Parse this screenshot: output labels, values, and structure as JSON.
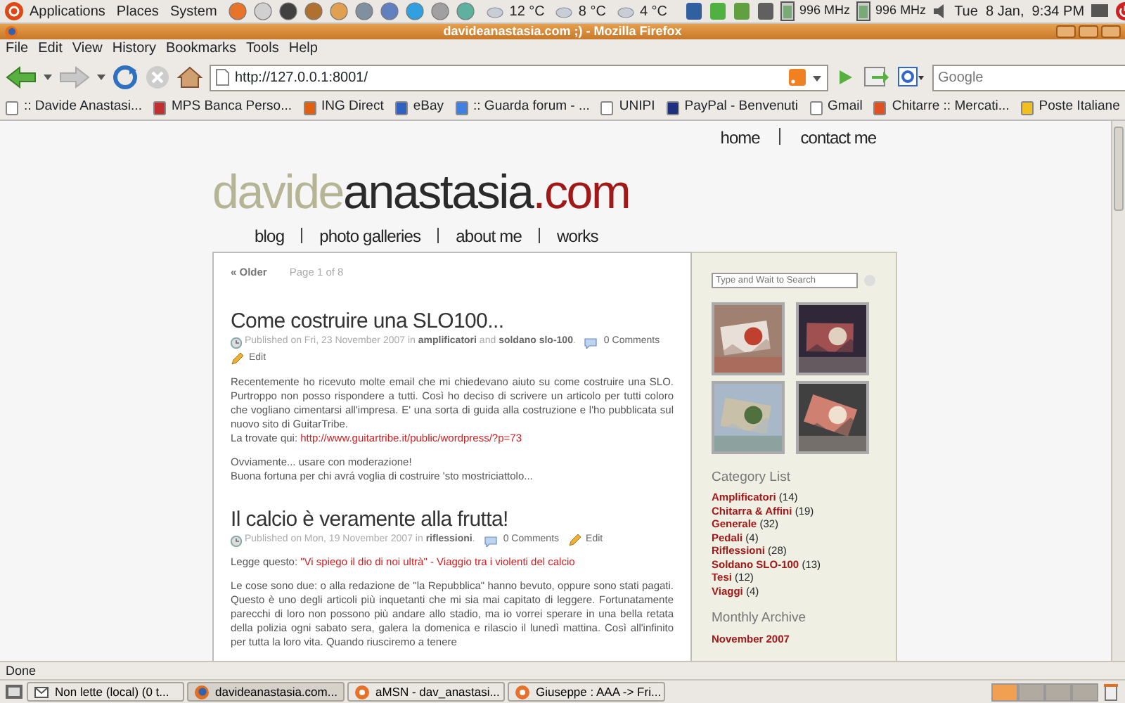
{
  "top_panel": {
    "menus": [
      "Applications",
      "Places",
      "System"
    ],
    "launchers": [
      {
        "color": "#e8742a"
      },
      {
        "color": "#d0d0d0"
      },
      {
        "color": "#404040"
      },
      {
        "color": "#b07030"
      },
      {
        "color": "#e0a050"
      },
      {
        "color": "#8090a0"
      },
      {
        "color": "#6080c0"
      },
      {
        "color": "#30a0e0"
      },
      {
        "color": "#a0a0a0"
      },
      {
        "color": "#60b0a0"
      }
    ],
    "weather": [
      {
        "temp": "12 °C"
      },
      {
        "temp": "8 °C"
      },
      {
        "temp": "4 °C"
      }
    ],
    "cpu": [
      "996 MHz",
      "996 MHz"
    ],
    "clock": "Tue  8 Jan,  9:34 PM"
  },
  "window": {
    "title": "davideanastasia.com ;) - Mozilla Firefox"
  },
  "menu_bar": [
    "File",
    "Edit",
    "View",
    "History",
    "Bookmarks",
    "Tools",
    "Help"
  ],
  "toolbar": {
    "url": "http://127.0.0.1:8001/",
    "search": {
      "placeholder": "Google"
    }
  },
  "bookmarks": [
    {
      "label": ":: Davide Anastasi...",
      "color": "#ffffff"
    },
    {
      "label": "MPS Banca Perso...",
      "color": "#c03030"
    },
    {
      "label": "ING Direct",
      "color": "#e06010"
    },
    {
      "label": "eBay",
      "color": "#3060c0"
    },
    {
      "label": ":: Guarda forum - ...",
      "color": "#4080e0"
    },
    {
      "label": "UNIPI",
      "color": "#ffffff"
    },
    {
      "label": "PayPal - Benvenuti",
      "color": "#203080"
    },
    {
      "label": "Gmail",
      "color": "#ffffff"
    },
    {
      "label": "Chitarre :: Mercati...",
      "color": "#e05020"
    },
    {
      "label": "Poste Italiane",
      "color": "#f0c020"
    }
  ],
  "page": {
    "top_links": [
      "home",
      "contact me"
    ],
    "logo": [
      {
        "text": "davide",
        "color": "#b5b596"
      },
      {
        "text": "anastasia",
        "color": "#2a2a2a"
      },
      {
        "text": ".com",
        "color": "#a01818"
      }
    ],
    "nav": [
      "blog",
      "photo galleries",
      "about me",
      "works"
    ],
    "pager": {
      "older": "« Older",
      "page": "Page 1 of 8"
    },
    "posts": [
      {
        "title": "Come costruire una SLO100...",
        "meta": "Published on Fri, 23 November 2007 in **amplificatori** and **soldano slo-100**.",
        "comments": "0 Comments",
        "edit": "Edit",
        "paragraphs": [
          [
            {
              "text": "Recentemente ho ricevuto molte email che mi chiedevano aiuto su come costruire una SLO. Purtroppo non posso rispondere a tutti. Così ho deciso di scrivere un articolo per tutti coloro che vogliano cimentarsi all'impresa. E' una sorta di guida alla costruzione e l'ho pubblicata sul nuovo sito di GuitarTribe."
            },
            {
              "text": "La trovate qui:",
              "link": "http://www.guitartribe.it/public/wordpress/?p=73"
            }
          ],
          [
            {
              "text": "Ovviamente... usare con moderazione!"
            },
            {
              "text": "Buona fortuna per chi avrá voglia di costruire 'sto mostriciattolo..."
            }
          ]
        ]
      },
      {
        "title": "Il calcio è veramente alla frutta!",
        "meta": "Published on Mon, 19 November 2007 in **riflessioni**.",
        "comments": "0 Comments",
        "edit": "Edit",
        "paragraphs": [
          [
            {
              "text": "Legge questo:",
              "link": "\"Vi spiego il dio di noi ultrà\" - Viaggio tra i violenti del calcio"
            }
          ],
          [
            {
              "text": "Le cose sono due: o alla redazione de \"la Repubblica\" hanno bevuto, oppure sono stati pagati. Questo è uno degli articoli più inquetanti che mi sia mai capitato di leggere. Fortunatamente parecchi di loro non possono più andare allo stadio, ma io vorrei sperare in una bella retata della polizia ogni sabato sera, galera la domenica e rilascio il lunedì mattina. Così all'infinito per tutta la loro vita. Quando riusciremo a tenere"
            }
          ]
        ]
      }
    ],
    "sidebar": {
      "search": {
        "placeholder": "Type and Wait to Search"
      },
      "photos": [
        {
          "kind": "picture"
        },
        {
          "kind": "picture"
        },
        {
          "kind": "picture"
        },
        {
          "kind": "picture"
        }
      ],
      "category_heading": "Category List",
      "categories": [
        {
          "name": "Amplificatori",
          "count": "(14)"
        },
        {
          "name": "Chitarra & Affini",
          "count": "(19)"
        },
        {
          "name": "Generale",
          "count": "(32)"
        },
        {
          "name": "Pedali",
          "count": "(4)"
        },
        {
          "name": "Riflessioni",
          "count": "(28)"
        },
        {
          "name": "Soldano SLO-100",
          "count": "(13)"
        },
        {
          "name": "Tesi",
          "count": "(12)"
        },
        {
          "name": "Viaggi",
          "count": "(4)"
        }
      ],
      "archive_heading": "Monthly Archive",
      "archive": [
        "November 2007"
      ]
    }
  },
  "status_bar": "Done",
  "taskbar": {
    "tasks": [
      {
        "label": "Non lette (local) (0 t...",
        "kind": "mail",
        "selected": false
      },
      {
        "label": "davideanastasia.com...",
        "kind": "firefox",
        "selected": true
      },
      {
        "label": "aMSN - dav_anastasi...",
        "kind": "gear",
        "selected": false
      },
      {
        "label": "Giuseppe : AAA -> Fri...",
        "kind": "gear",
        "selected": false
      }
    ],
    "workspaces": [
      {
        "selected": true
      },
      {
        "selected": false
      },
      {
        "selected": false
      },
      {
        "selected": false
      }
    ]
  }
}
